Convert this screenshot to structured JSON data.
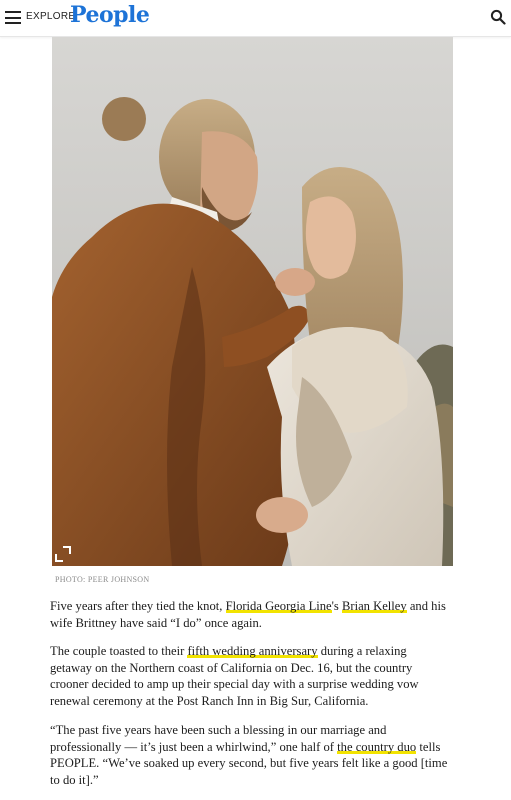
{
  "header": {
    "menu_icon": "hamburger-menu-icon",
    "explore_label": "EXPLORE",
    "logo_text": "People",
    "logo_color": "#1d73d7",
    "search_icon": "search-icon"
  },
  "hero": {
    "photo_credit": "PHOTO: PEER JOHNSON",
    "expand_icon": "expand-icon"
  },
  "article": {
    "link_underline_color": "#f2e300",
    "p1": {
      "t1": "Five years after they tied the knot, ",
      "link1": "Florida Georgia Line",
      "t2": "'s ",
      "link2": "Brian Kelley",
      "t3": " and his wife Brittney have said “I do” once again."
    },
    "p2": {
      "t1": "The couple toasted to their ",
      "link1": "fifth wedding anniversary",
      "t2": " during a relaxing getaway on the Northern coast of California on Dec. 16, but the country crooner decided to amp up their special day with a surprise wedding vow renewal ceremony at the Post Ranch Inn in Big Sur, California."
    },
    "p3": {
      "t1": "“The past five years have been such a blessing in our marriage and professionally — it’s just been a whirlwind,” one half of ",
      "link1": "the country duo",
      "t2": " tells PEOPLE. “We’ve soaked up every second, but five years felt like a good [time to do it].”"
    }
  }
}
